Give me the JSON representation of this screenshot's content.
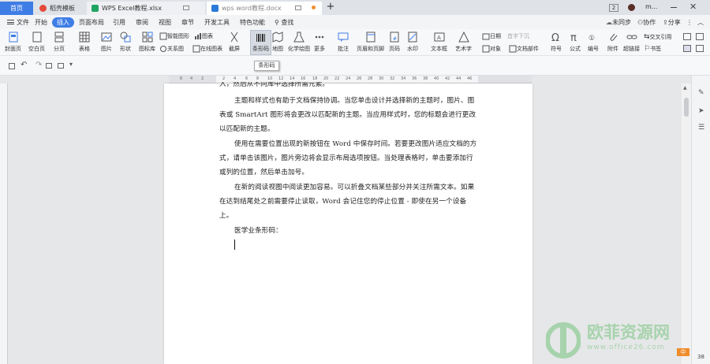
{
  "tabs": [
    {
      "label": "首页",
      "active": true
    },
    {
      "label": "稻壳模板"
    },
    {
      "label": "WPS Excel教程.xlsx"
    },
    {
      "label": "wps word教程.docx"
    }
  ],
  "title_right": {
    "badge": "2",
    "user": "m..."
  },
  "menu": {
    "file": "文件",
    "items": [
      "开始",
      "插入",
      "页面布局",
      "引用",
      "审阅",
      "视图",
      "章节",
      "开发工具",
      "特色功能"
    ],
    "search": "查找",
    "unsync": "未同步",
    "collab": "协作",
    "share": "分享"
  },
  "ribbon": {
    "cover": "封面页",
    "blank": "空白页",
    "pagebreak": "分页",
    "table": "表格",
    "picture": "图片",
    "shapes": "形状",
    "iconlib": "图标库",
    "smartart": "智能图形",
    "chart": "图表",
    "relation": "关系图",
    "online_chart": "在线图表",
    "screenshot": "截屏",
    "barcode": "条形码",
    "map": "地图",
    "chemistry": "化学绘图",
    "more": "更多",
    "comment": "批注",
    "header_footer": "页眉和页脚",
    "page_num": "页码",
    "watermark": "水印",
    "textbox": "文本框",
    "wordart": "艺术字",
    "date": "日期",
    "drop_cap": "首字下沉",
    "object": "对象",
    "doc_parts": "文档部件",
    "symbol": "符号",
    "formula": "公式",
    "numbering": "编号",
    "attachment": "附件",
    "hyperlink": "超链接",
    "cross_ref": "交叉引用",
    "bookmark": "书签"
  },
  "tooltip": "条形码",
  "ruler_numbers": [
    "6",
    "4",
    "2",
    "2",
    "4",
    "6",
    "8",
    "10",
    "12",
    "14",
    "16",
    "18",
    "20",
    "22",
    "24",
    "26",
    "28",
    "30",
    "32",
    "34",
    "36",
    "38",
    "40",
    "42",
    "44",
    "46"
  ],
  "document": {
    "line0": "入，然后从不同库中选择所需元素。",
    "p1": "主题和样式也有助于文档保持协调。当您单击设计并选择新的主题时，图片、图表或 SmartArt 图形将会更改以匹配新的主题。当应用样式时，您的标题会进行更改以匹配新的主题。",
    "p2": "使用在需要位置出现的新按钮在 Word 中保存时间。若要更改图片适应文档的方式，请单击该图片，图片旁边将会显示布局选项按钮。当处理表格时，单击要添加行或列的位置，然后单击加号。",
    "p3": "在新的阅读视图中阅读更加容易。可以折叠文档某些部分并关注所需文本。如果在达到结尾处之前需要停止读取，Word 会记住您的停止位置 - 即使在另一个设备上。",
    "p4": "医学业条形码："
  },
  "watermark": {
    "brand": "欧菲资源网",
    "url": "www.office26.com"
  },
  "status": {
    "input_mode": "中",
    "sub": "38"
  },
  "colors": {
    "accent": "#3f7de6",
    "tab_home": "#3f7de6"
  }
}
